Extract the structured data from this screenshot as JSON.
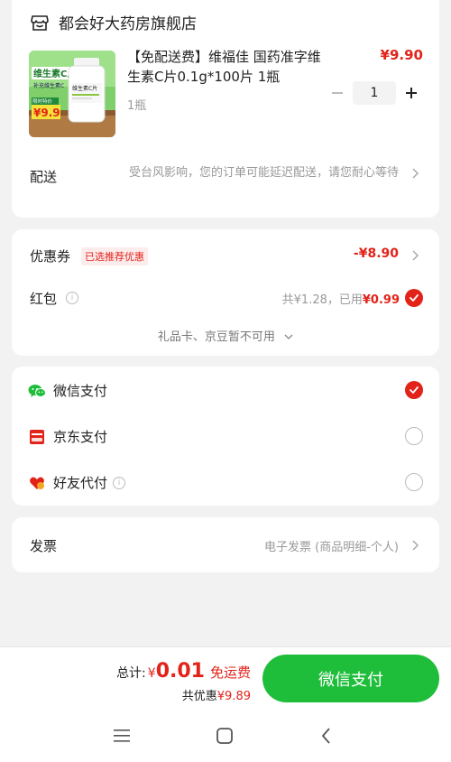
{
  "store": {
    "name": "都会好大药房旗舰店",
    "icon": "store-icon"
  },
  "product": {
    "title": "【免配送费】维福佳 国药准字维生素C片0.1g*100片 1瓶",
    "price": "¥9.90",
    "spec": "1瓶",
    "quantity": "1",
    "image": {
      "brand_text": "维生素C片",
      "sub_text": "补充维生素C",
      "bottle_label": "维生素C片",
      "promo_text": "¥9.9",
      "promo_badge": "限时特价"
    }
  },
  "delivery": {
    "label": "配送",
    "notice": "受台风影响，您的订单可能延迟配送，请您耐心等待"
  },
  "promotions": {
    "coupon_label": "优惠券",
    "coupon_tag": "已选推荐优惠",
    "coupon_value": "-¥8.90",
    "redpack_label": "红包",
    "redpack_total": "共¥1.28，已用",
    "redpack_used": "¥0.99",
    "giftcard_text": "礼品卡、京豆暂不可用"
  },
  "payment": {
    "options": [
      {
        "label": "微信支付",
        "icon": "wechat-icon",
        "selected": true
      },
      {
        "label": "京东支付",
        "icon": "jd-pay-icon",
        "selected": false
      },
      {
        "label": "好友代付",
        "icon": "friend-pay-icon",
        "selected": false
      }
    ]
  },
  "invoice": {
    "label": "发票",
    "value": "电子发票 (商品明细-个人)"
  },
  "checkout": {
    "total_label": "总计:",
    "currency": "¥",
    "total_amount": "0.01",
    "free_shipping": "免运费",
    "saved_label": "共优惠",
    "saved_amount": "¥9.89",
    "pay_button": "微信支付"
  },
  "colors": {
    "accent_red": "#e2231a",
    "pay_green": "#1fbe3a"
  }
}
